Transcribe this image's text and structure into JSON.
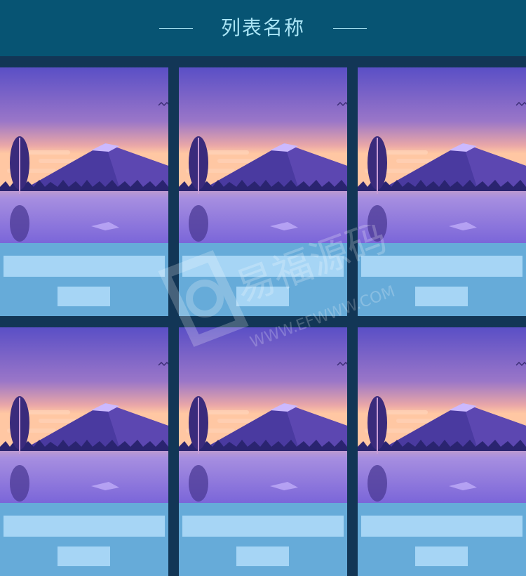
{
  "header": {
    "title": "列表名称"
  },
  "cards": [
    {
      "id": 1
    },
    {
      "id": 2
    },
    {
      "id": 3
    },
    {
      "id": 4
    },
    {
      "id": 5
    },
    {
      "id": 6
    }
  ],
  "watermark": {
    "brand": "易福源码",
    "url": "WWW.EFWWW.COM"
  },
  "colors": {
    "page_bg": "#123656",
    "header_bg": "#075473",
    "title_color": "#a9e3f4",
    "info_bg": "#66abd9",
    "placeholder": "#a6d5f5"
  }
}
